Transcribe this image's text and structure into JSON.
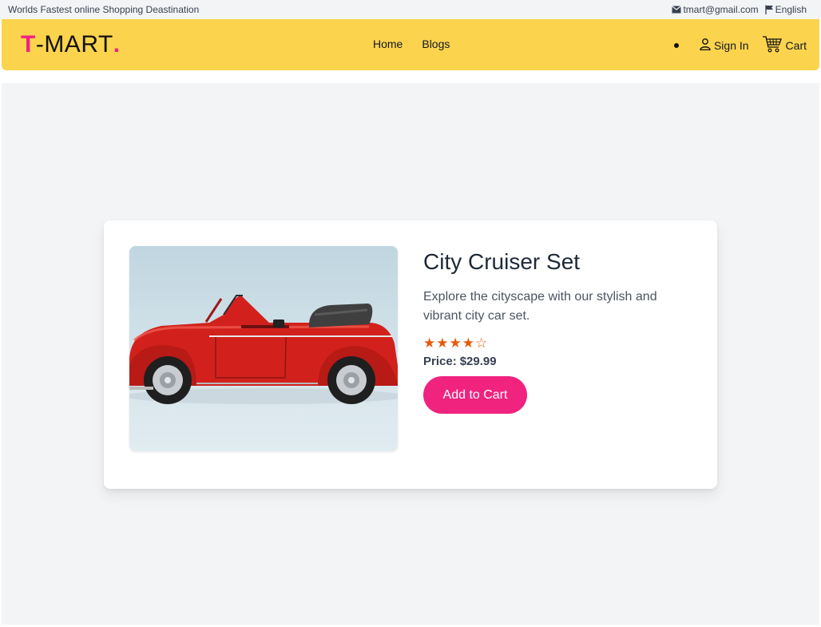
{
  "topbar": {
    "tagline": "Worlds Fastest online Shopping Deastination",
    "email": "tmart@gmail.com",
    "email_icon": "envelope-icon",
    "language": "English",
    "language_icon": "flag-icon"
  },
  "navbar": {
    "logo_t": "T",
    "logo_rest": "-MART",
    "logo_dot": ".",
    "links": [
      "Home",
      "Blogs"
    ],
    "signin_label": "Sign In",
    "signin_icon": "user-icon",
    "cart_label": "Cart",
    "cart_icon": "cart-icon"
  },
  "product": {
    "title": "City Cruiser Set",
    "description": "Explore the cityscape with our stylish and vibrant city car set.",
    "rating": {
      "stars": [
        "★",
        "★",
        "★",
        "★",
        "☆"
      ],
      "value": 4,
      "max": 5
    },
    "price_label": "Price:",
    "price_value": "$29.99",
    "add_to_cart_label": "Add to Cart",
    "image": "red-convertible-toy-car"
  },
  "colors": {
    "accent": "#f0237f",
    "navbar_bg": "#fcd34d",
    "star": "#ea580c",
    "page_bg": "#f3f4f6"
  }
}
